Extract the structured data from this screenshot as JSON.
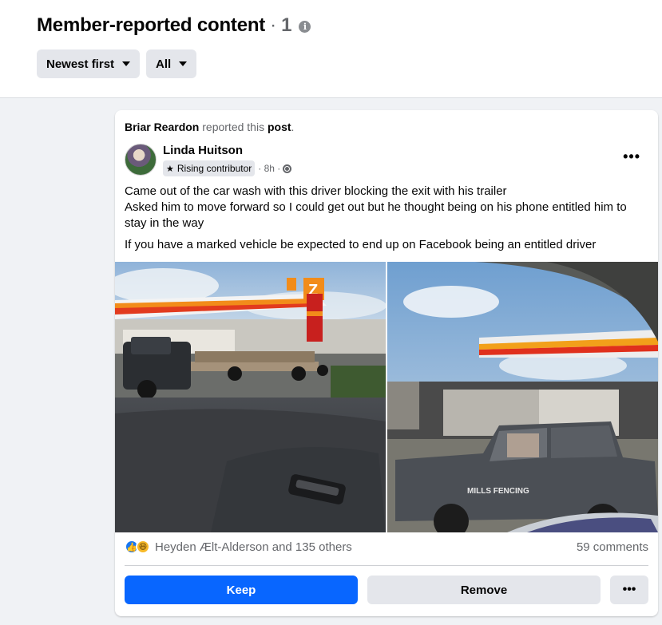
{
  "header": {
    "title": "Member-reported content",
    "separator": "·",
    "count": "1",
    "info_glyph": "i"
  },
  "filters": {
    "sort_label": "Newest first",
    "type_label": "All"
  },
  "report": {
    "reporter": "Briar Reardon",
    "middle_text": " reported this ",
    "object": "post",
    "end": "."
  },
  "post": {
    "author": "Linda Huitson",
    "badge": "Rising contributor",
    "time": "· 8h ·",
    "more_glyph": "•••",
    "lines": [
      "Came out of the car wash with this driver blocking the exit with his trailer",
      "Asked him to move forward so I could get out but he thought being on his phone entitled him to stay in the way"
    ],
    "paragraph2": "If you have a marked vehicle be expected to end up on Facebook being an entitled driver",
    "icons": [
      "star-icon",
      "globe-icon"
    ]
  },
  "photos": {
    "photo1_sign": "Z",
    "photo2_truck_text": "MILLS FENCING"
  },
  "reactions": {
    "names": "Heyden Ælt-Alderson and 135 others",
    "comments": "59 comments",
    "icons": [
      "like-icon",
      "haha-icon"
    ]
  },
  "actions": {
    "keep": "Keep",
    "remove": "Remove",
    "more": "•••"
  },
  "colors": {
    "primary": "#0866ff",
    "secondary_bg": "#e4e6eb",
    "page_bg": "#f0f2f5"
  }
}
